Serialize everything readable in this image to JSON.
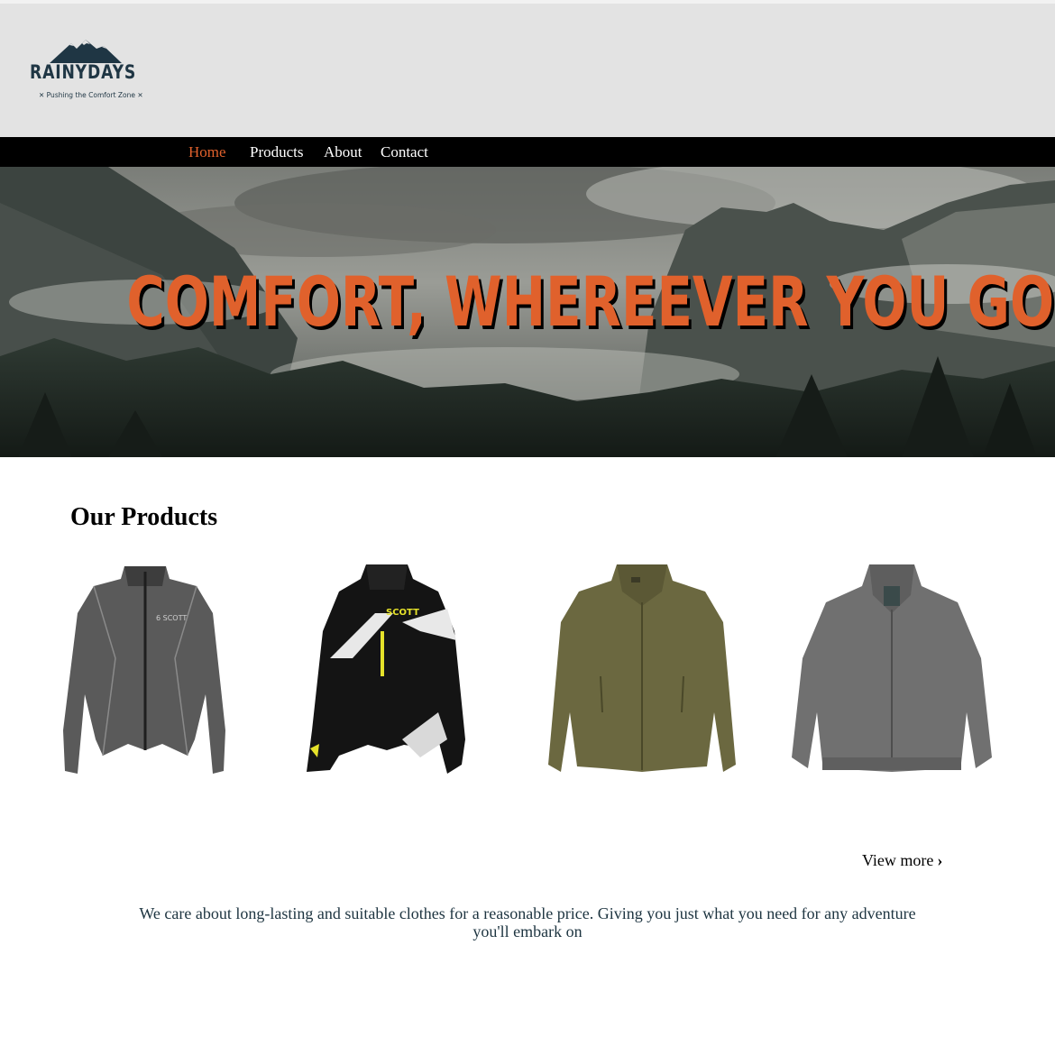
{
  "brand": {
    "name": "RAINYDAYS",
    "tagline": "✕ Pushing the Comfort Zone ✕",
    "color": "#1f3644"
  },
  "nav": {
    "items": [
      {
        "label": "Home",
        "active": true
      },
      {
        "label": "Products",
        "active": false
      },
      {
        "label": "About",
        "active": false
      },
      {
        "label": "Contact",
        "active": false
      }
    ],
    "active_color": "#e0612c"
  },
  "hero": {
    "title": "COMFORT, WHEREEVER YOU GO",
    "title_color": "#e0612c"
  },
  "products": {
    "heading": "Our Products",
    "items": [
      {
        "icon": "grey-running-jacket-image"
      },
      {
        "icon": "black-motocross-jacket-image"
      },
      {
        "icon": "olive-fleece-jacket-image"
      },
      {
        "icon": "grey-bomber-jacket-image"
      }
    ],
    "view_more": "View more"
  },
  "about": {
    "text": "We care about long-lasting and suitable clothes for a reasonable price. Giving you just what you need for any adventure you'll embark on"
  }
}
